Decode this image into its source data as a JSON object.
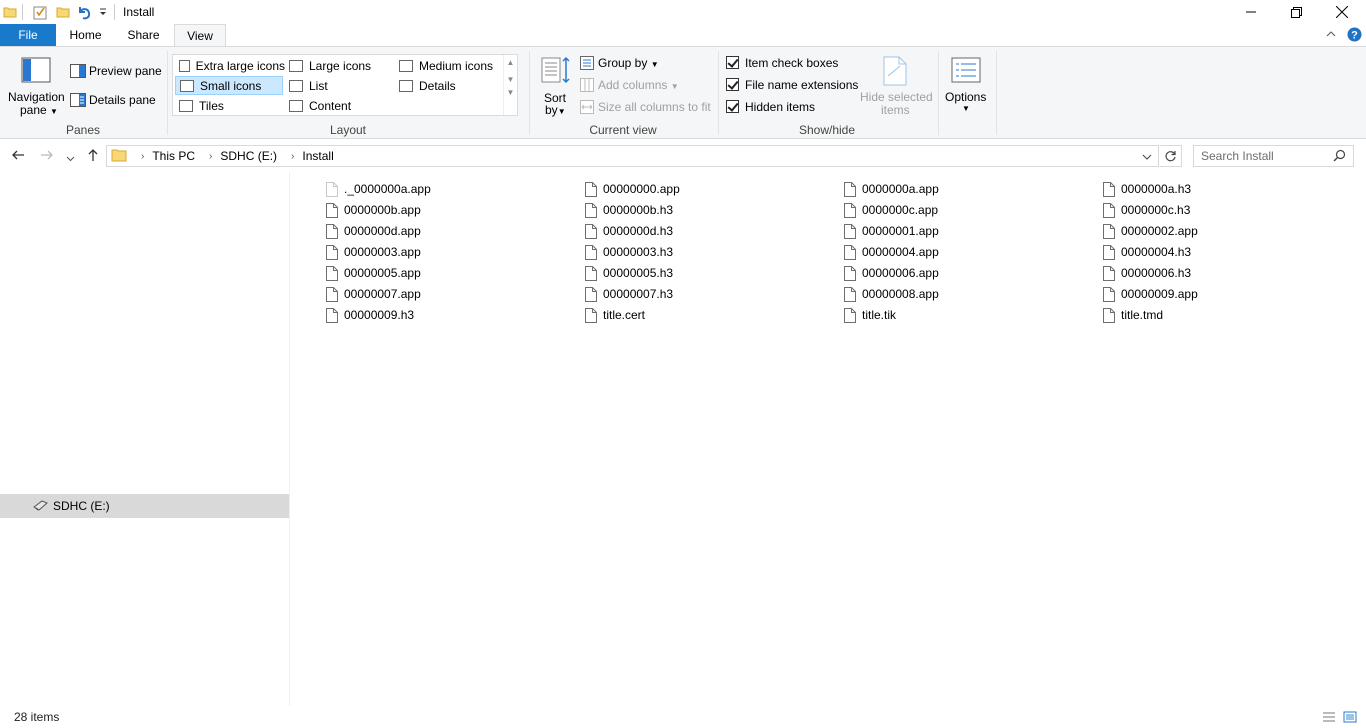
{
  "window": {
    "title": "Install"
  },
  "tabs": [
    {
      "label": "File"
    },
    {
      "label": "Home"
    },
    {
      "label": "Share"
    },
    {
      "label": "View"
    }
  ],
  "ribbon": {
    "panes": {
      "navigation_pane_line1": "Navigation",
      "navigation_pane_line2": "pane",
      "preview_pane": "Preview pane",
      "details_pane": "Details pane",
      "label": "Panes"
    },
    "layout": {
      "items": [
        "Extra large icons",
        "Large icons",
        "Medium icons",
        "Small icons",
        "List",
        "Details",
        "Tiles",
        "Content"
      ],
      "selected": "Small icons",
      "label": "Layout"
    },
    "current_view": {
      "sort_line1": "Sort",
      "sort_line2": "by",
      "group_by": "Group by",
      "add_columns": "Add columns",
      "size_all_columns": "Size all columns to fit",
      "label": "Current view"
    },
    "show_hide": {
      "item_check_boxes": "Item check boxes",
      "file_name_extensions": "File name extensions",
      "hidden_items": "Hidden items",
      "hide_selected_line1": "Hide selected",
      "hide_selected_line2": "items",
      "label": "Show/hide"
    },
    "options": {
      "label": "Options"
    }
  },
  "address": {
    "crumbs": [
      "This PC",
      "SDHC (E:)",
      "Install"
    ],
    "search_placeholder": "Search Install"
  },
  "nav_pane": {
    "selected_item": "SDHC (E:)"
  },
  "files": [
    "._0000000a.app",
    "00000000.app",
    "0000000a.app",
    "0000000a.h3",
    "0000000b.app",
    "0000000b.h3",
    "0000000c.app",
    "0000000c.h3",
    "0000000d.app",
    "0000000d.h3",
    "00000001.app",
    "00000002.app",
    "00000003.app",
    "00000003.h3",
    "00000004.app",
    "00000004.h3",
    "00000005.app",
    "00000005.h3",
    "00000006.app",
    "00000006.h3",
    "00000007.app",
    "00000007.h3",
    "00000008.app",
    "00000009.app",
    "00000009.h3",
    "title.cert",
    "title.tik",
    "title.tmd"
  ],
  "status": {
    "item_count": "28 items"
  },
  "colors": {
    "file_tab": "#1979ca",
    "ribbon_bg": "#f5f6f7",
    "selected_bg": "#cce8ff",
    "nav_selected": "#d9d9d9"
  }
}
